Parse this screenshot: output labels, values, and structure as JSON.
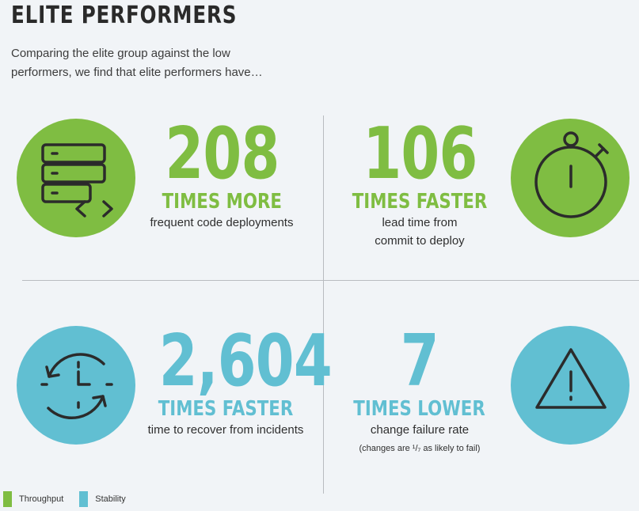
{
  "header": {
    "title": "ELITE PERFORMERS",
    "intro": "Comparing the elite group against the low performers, we find that elite performers have…"
  },
  "stats": [
    {
      "value": "208",
      "unit": "TIMES MORE",
      "desc_lines": [
        "frequent code deployments"
      ],
      "category": "Throughput",
      "icon": "server-code-icon"
    },
    {
      "value": "106",
      "unit": "TIMES FASTER",
      "desc_lines": [
        "lead time from",
        "commit to deploy"
      ],
      "category": "Throughput",
      "icon": "stopwatch-icon"
    },
    {
      "value": "2,604",
      "unit": "TIMES FASTER",
      "desc_lines": [
        "time to recover from incidents"
      ],
      "category": "Stability",
      "icon": "clock-recover-icon"
    },
    {
      "value": "7",
      "unit": "TIMES LOWER",
      "desc_lines": [
        "change failure rate"
      ],
      "note": "(changes are ¹/₇ as likely to fail)",
      "category": "Stability",
      "icon": "warning-icon"
    }
  ],
  "legend": [
    {
      "label": "Throughput",
      "color": "#7fbd42"
    },
    {
      "label": "Stability",
      "color": "#61bfd2"
    }
  ],
  "colors": {
    "throughput": "#7fbd42",
    "stability": "#61bfd2",
    "background": "#f1f4f7"
  }
}
